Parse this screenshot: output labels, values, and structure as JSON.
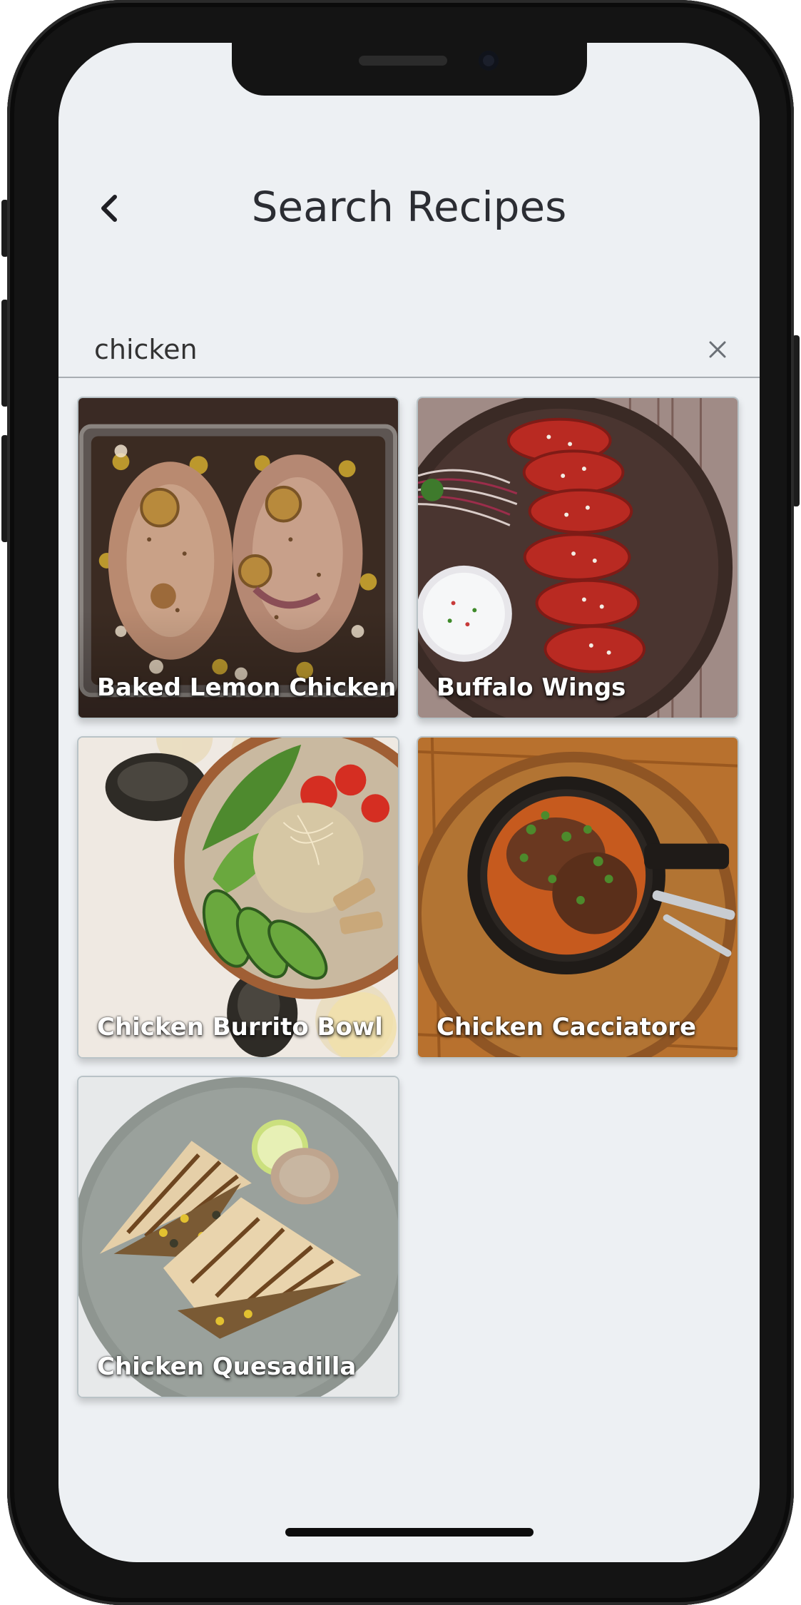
{
  "header": {
    "title": "Search Recipes",
    "back_icon": "chevron-left-icon"
  },
  "search": {
    "value": "chicken",
    "placeholder": "",
    "clear_icon": "close-icon"
  },
  "recipes": [
    {
      "name": "Baked Lemon Chicken"
    },
    {
      "name": "Buffalo Wings"
    },
    {
      "name": "Chicken Burrito Bowl"
    },
    {
      "name": "Chicken Cacciatore"
    },
    {
      "name": "Chicken Quesadilla"
    }
  ],
  "colors": {
    "screen_background": "#edf0f3",
    "title_text": "#2b2d33",
    "divider": "#a8adb2",
    "card_title_text": "#ffffff"
  }
}
